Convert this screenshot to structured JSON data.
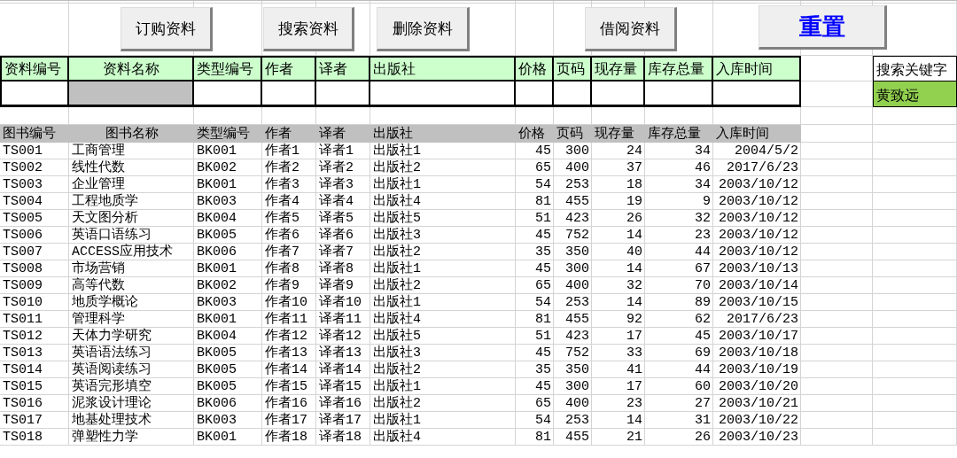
{
  "buttons": [
    {
      "label": "订购资料",
      "kind": "action"
    },
    {
      "label": "搜索资料",
      "kind": "action"
    },
    {
      "label": "删除资料",
      "kind": "action"
    },
    {
      "label": "借阅资料",
      "kind": "action"
    },
    {
      "label": "重置",
      "kind": "reset"
    }
  ],
  "form": {
    "fields": [
      {
        "label": "资料编号",
        "selected": false
      },
      {
        "label": "资料名称",
        "selected": true
      },
      {
        "label": "类型编号",
        "selected": false
      },
      {
        "label": "作者",
        "selected": false
      },
      {
        "label": "译者",
        "selected": false
      },
      {
        "label": "出版社",
        "selected": false
      },
      {
        "label": "价格",
        "selected": false
      },
      {
        "label": "页码",
        "selected": false
      },
      {
        "label": "现存量",
        "selected": false
      },
      {
        "label": "库存总量",
        "selected": false
      },
      {
        "label": "入库时间",
        "selected": false
      }
    ]
  },
  "search": {
    "label": "搜索关键字",
    "value": "黄致远"
  },
  "table": {
    "columns": [
      "图书编号",
      "图书名称",
      "类型编号",
      "作者",
      "译者",
      "出版社",
      "价格",
      "页码",
      "现存量",
      "库存总量",
      "入库时间"
    ],
    "rows": [
      [
        "TS001",
        "工商管理",
        "BK001",
        "作者1",
        "译者1",
        "出版社1",
        "45",
        "300",
        "24",
        "34",
        "2004/5/2"
      ],
      [
        "TS002",
        "线性代数",
        "BK002",
        "作者2",
        "译者2",
        "出版社2",
        "65",
        "400",
        "37",
        "46",
        "2017/6/23"
      ],
      [
        "TS003",
        "企业管理",
        "BK001",
        "作者3",
        "译者3",
        "出版社1",
        "54",
        "253",
        "18",
        "34",
        "2003/10/12"
      ],
      [
        "TS004",
        "工程地质学",
        "BK003",
        "作者4",
        "译者4",
        "出版社4",
        "81",
        "455",
        "19",
        "9",
        "2003/10/12"
      ],
      [
        "TS005",
        "天文图分析",
        "BK004",
        "作者5",
        "译者5",
        "出版社5",
        "51",
        "423",
        "26",
        "32",
        "2003/10/12"
      ],
      [
        "TS006",
        "英语口语练习",
        "BK005",
        "作者6",
        "译者6",
        "出版社3",
        "45",
        "752",
        "14",
        "23",
        "2003/10/12"
      ],
      [
        "TS007",
        "ACCESS应用技术",
        "BK006",
        "作者7",
        "译者7",
        "出版社2",
        "35",
        "350",
        "40",
        "44",
        "2003/10/12"
      ],
      [
        "TS008",
        "市场营销",
        "BK001",
        "作者8",
        "译者8",
        "出版社1",
        "45",
        "300",
        "14",
        "67",
        "2003/10/13"
      ],
      [
        "TS009",
        "高等代数",
        "BK002",
        "作者9",
        "译者9",
        "出版社2",
        "65",
        "400",
        "32",
        "70",
        "2003/10/14"
      ],
      [
        "TS010",
        "地质学概论",
        "BK003",
        "作者10",
        "译者10",
        "出版社1",
        "54",
        "253",
        "14",
        "89",
        "2003/10/15"
      ],
      [
        "TS011",
        "管理科学",
        "BK001",
        "作者11",
        "译者11",
        "出版社4",
        "81",
        "455",
        "92",
        "62",
        "2017/6/23"
      ],
      [
        "TS012",
        "天体力学研究",
        "BK004",
        "作者12",
        "译者12",
        "出版社5",
        "51",
        "423",
        "17",
        "45",
        "2003/10/17"
      ],
      [
        "TS013",
        "英语语法练习",
        "BK005",
        "作者13",
        "译者13",
        "出版社3",
        "45",
        "752",
        "33",
        "69",
        "2003/10/18"
      ],
      [
        "TS014",
        "英语阅读练习",
        "BK005",
        "作者14",
        "译者14",
        "出版社2",
        "35",
        "350",
        "41",
        "44",
        "2003/10/19"
      ],
      [
        "TS015",
        "英语完形填空",
        "BK005",
        "作者15",
        "译者15",
        "出版社1",
        "45",
        "300",
        "17",
        "60",
        "2003/10/20"
      ],
      [
        "TS016",
        "泥浆设计理论",
        "BK006",
        "作者16",
        "译者16",
        "出版社2",
        "65",
        "400",
        "23",
        "27",
        "2003/10/21"
      ],
      [
        "TS017",
        "地基处理技术",
        "BK003",
        "作者17",
        "译者17",
        "出版社1",
        "54",
        "253",
        "14",
        "31",
        "2003/10/22"
      ],
      [
        "TS018",
        "弹塑性力学",
        "BK001",
        "作者18",
        "译者18",
        "出版社4",
        "81",
        "455",
        "21",
        "26",
        "2003/10/23"
      ]
    ]
  }
}
